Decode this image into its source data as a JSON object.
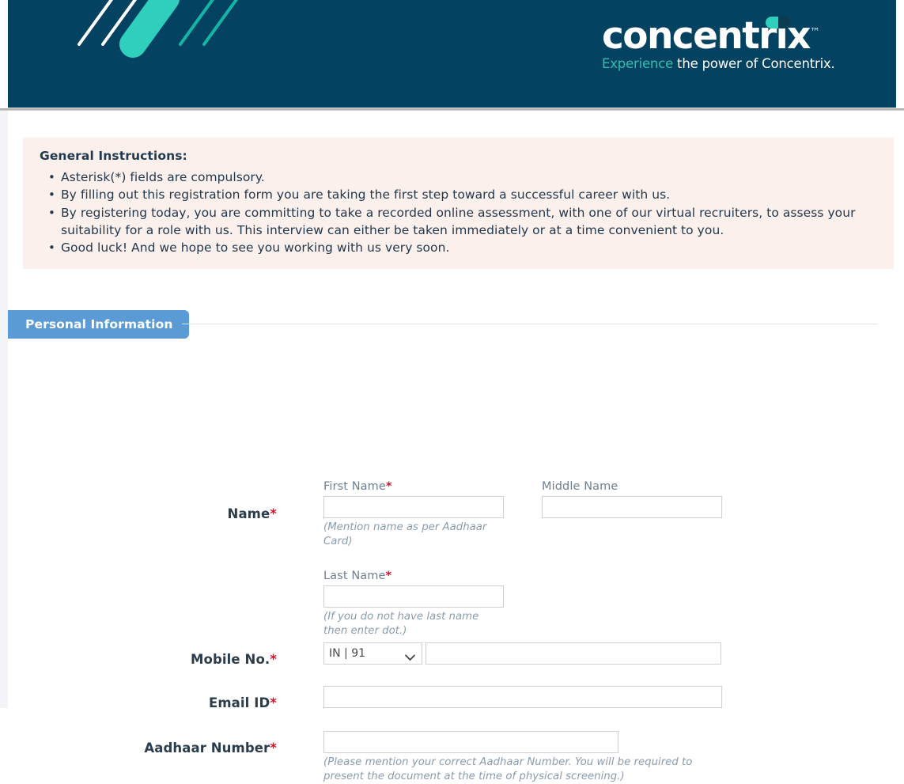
{
  "header": {
    "logo_icon": "concentrix-chevrons-logo",
    "brand_wordmark": "concentrix",
    "brand_trademark": "™",
    "tagline_accent": "Experience",
    "tagline_rest": " the power of Concentrix.",
    "band_color": "#044261",
    "accent_color": "#2ed0bd"
  },
  "instructions": {
    "title": "General Instructions:",
    "items": [
      "Asterisk(*) fields are compulsory.",
      "By filling out this registration form you are taking the first step toward a successful career with us.",
      "By registering today, you are committing to take a recorded online assessment, with one of our virtual recruiters, to assess your suitability for a role with us. This interview can either be taken immediately or at a time convenient to you.",
      "Good luck! And we hope to see you working with us very soon."
    ],
    "background_color": "#fbf0eb"
  },
  "tabs": {
    "active_label": "Personal Information",
    "active_color": "#5b9bd5"
  },
  "form": {
    "required_marker": "*",
    "required_color": "#d7122b",
    "name": {
      "label": "Name",
      "required": true,
      "first": {
        "label": "First Name",
        "required": true,
        "value": "",
        "placeholder": "",
        "hint": "(Mention name as per Aadhaar Card)"
      },
      "middle": {
        "label": "Middle Name",
        "required": false,
        "value": "",
        "placeholder": ""
      },
      "last": {
        "label": "Last Name",
        "required": true,
        "value": "",
        "placeholder": "",
        "hint": "(If you do not have last name then enter dot.)"
      }
    },
    "mobile": {
      "label": "Mobile No.",
      "required": true,
      "country_code_selected": "IN | 91",
      "country_code_options": [
        "IN | 91"
      ],
      "value": "",
      "placeholder": ""
    },
    "email": {
      "label": "Email ID",
      "required": true,
      "value": "",
      "placeholder": ""
    },
    "aadhaar": {
      "label": "Aadhaar Number",
      "required": true,
      "value": "",
      "placeholder": "",
      "hint": "(Please mention your correct Aadhaar Number. You will be required to present the document at the time of physical screening.)"
    }
  }
}
